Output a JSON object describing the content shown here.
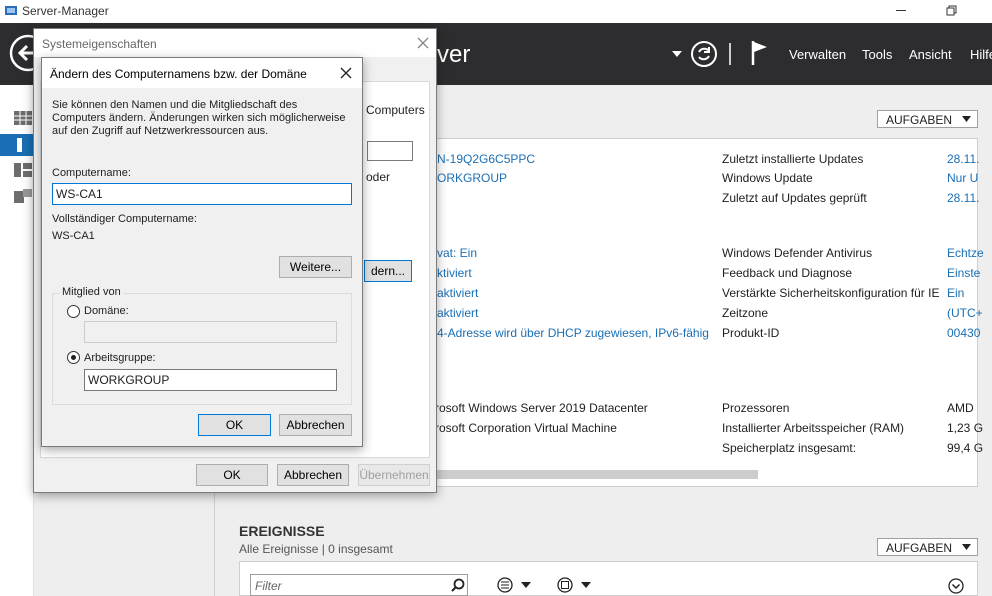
{
  "app": {
    "title": "Server-Manager",
    "header_fragment": "ver",
    "menu": [
      "Verwalten",
      "Tools",
      "Ansicht",
      "Hilfe"
    ],
    "tasks_label": "AUFGABEN"
  },
  "properties": {
    "partial_top_text": "Computers",
    "partial_or": "oder",
    "partial_change_button": "dern...",
    "left_values": [
      "N-19Q2G6C5PPC",
      "ORKGROUP",
      "vat: Ein",
      "ktiviert",
      "aktiviert",
      "aktiviert",
      "4-Adresse wird über DHCP zugewiesen, IPv6-fähig",
      "crosoft Windows Server 2019 Datacenter",
      "crosoft Corporation Virtual Machine"
    ],
    "right_labels": [
      "Zuletzt installierte Updates",
      "Windows Update",
      "Zuletzt auf Updates geprüft",
      "Windows Defender Antivirus",
      "Feedback und Diagnose",
      "Verstärkte Sicherheitskonfiguration für IE",
      "Zeitzone",
      "Produkt-ID",
      "Prozessoren",
      "Installierter Arbeitsspeicher (RAM)",
      "Speicherplatz insgesamt:"
    ],
    "right_values": [
      "28.11.",
      "Nur U",
      "28.11.",
      "Echtze",
      "Einste",
      "Ein",
      "(UTC+",
      "00430",
      "AMD",
      "1,23 G",
      "99,4 G"
    ]
  },
  "events": {
    "title": "EREIGNISSE",
    "subtitle": "Alle Ereignisse | 0 insgesamt",
    "filter_placeholder": "Filter"
  },
  "sysprops": {
    "title": "Systemeigenschaften",
    "ok": "OK",
    "cancel": "Abbrechen",
    "apply": "Übernehmen"
  },
  "rename": {
    "title": "Ändern des Computernamens bzw. der Domäne",
    "description": "Sie können den Namen und die Mitgliedschaft des Computers ändern. Änderungen wirken sich möglicherweise auf den Zugriff auf Netzwerkressourcen aus.",
    "computer_name_label": "Computername:",
    "computer_name_value": "WS-CA1",
    "full_name_label": "Vollständiger Computername:",
    "full_name_value": "WS-CA1",
    "more_button": "Weitere...",
    "member_of_label": "Mitglied von",
    "domain_label": "Domäne:",
    "domain_value": "",
    "workgroup_label": "Arbeitsgruppe:",
    "workgroup_value": "WORKGROUP",
    "ok": "OK",
    "cancel": "Abbrechen"
  }
}
